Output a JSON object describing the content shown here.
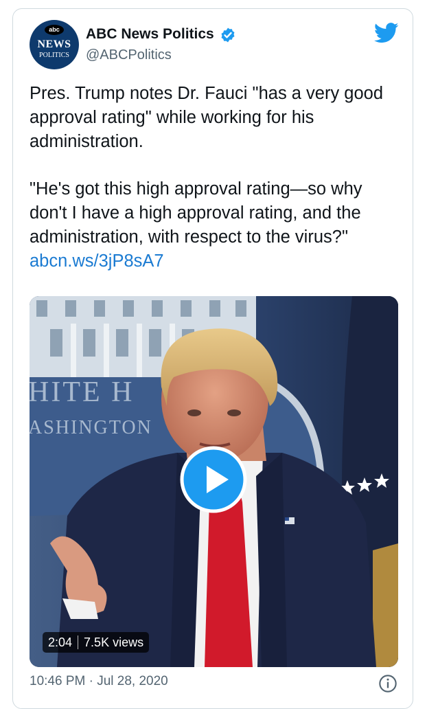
{
  "account": {
    "name": "ABC News Politics",
    "handle": "@ABCPolitics",
    "avatar_badge": "abc",
    "avatar_news": "NEWS",
    "avatar_politics": "POLITICS",
    "verified": true
  },
  "tweet": {
    "paragraph1": "Pres. Trump notes Dr. Fauci \"has a very good approval rating\" while working for his administration.",
    "paragraph2": "\"He's got this high approval rating—so why don't I have a high approval rating, and the administration, with respect to the virus?\"",
    "link": "abcn.ws/3jP8sA7"
  },
  "video": {
    "duration": "2:04",
    "views": "7.5K views",
    "backdrop_line1": "HITE H",
    "backdrop_line2": "ASHINGTON"
  },
  "timestamp": "10:46 PM · Jul 28, 2020",
  "icons": {
    "verified": "verified-badge-icon",
    "brand": "twitter-bird-icon",
    "play": "play-icon",
    "info": "info-icon"
  },
  "colors": {
    "twitter_blue": "#1d9bf0",
    "link": "#1b7bd2",
    "secondary_text": "#536471",
    "border": "#cfd9de"
  }
}
